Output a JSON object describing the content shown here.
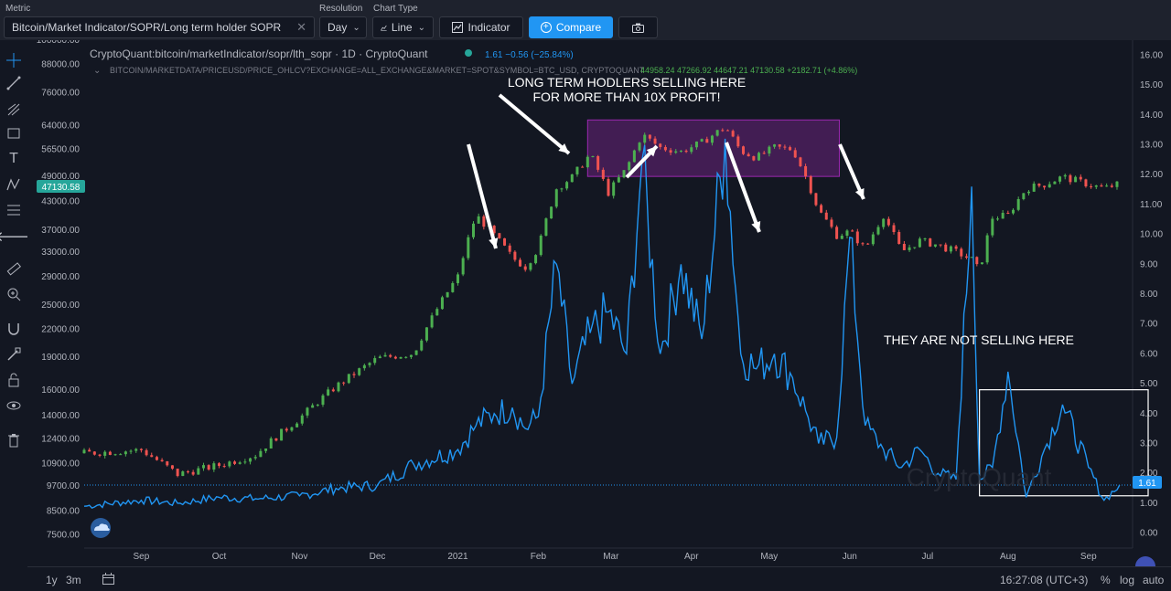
{
  "topbar": {
    "metric_label": "Metric",
    "metric_value": "Bitcoin/Market Indicator/SOPR/Long term holder SOPR",
    "resolution_label": "Resolution",
    "resolution_value": "Day",
    "chart_type_label": "Chart Type",
    "chart_type_value": "Line",
    "indicator_label": "Indicator",
    "compare_label": "Compare"
  },
  "legend": {
    "main_title": "CryptoQuant:bitcoin/marketIndicator/sopr/lth_sopr · 1D · CryptoQuant",
    "main_value": "1.61 −0.56 (−25.84%)",
    "price_title": "BITCOIN/MARKETDATA/PRICEUSD/PRICE_OHLCV?EXCHANGE=ALL_EXCHANGE&MARKET=SPOT&SYMBOL=BTC_USD, CRYPTOQUANT",
    "price_values": "44958.24 47266.92 44647.21 47130.58 +2182.71 (+4.86%)"
  },
  "price_badge": "47130.58",
  "sopr_badge": "1.61",
  "watermark": "CryptoQuant",
  "bottom": {
    "range_1y": "1y",
    "range_3m": "3m",
    "time": "16:27:08 (UTC+3)",
    "pct": "%",
    "log": "log",
    "auto": "auto"
  },
  "colors": {
    "background": "#131722",
    "sopr_line": "#2196f3",
    "candle_up": "#4caf50",
    "candle_down": "#ef5350",
    "badge_green": "#26a69a",
    "accent": "#2196f3"
  },
  "chart_data": {
    "type": "line",
    "x": [
      "2020-08-10",
      "2020-09-01",
      "2020-09-15",
      "2020-10-01",
      "2020-10-15",
      "2020-11-01",
      "2020-11-15",
      "2020-12-01",
      "2020-12-15",
      "2021-01-01",
      "2021-01-08",
      "2021-01-15",
      "2021-01-22",
      "2021-01-27",
      "2021-02-01",
      "2021-02-08",
      "2021-02-14",
      "2021-02-21",
      "2021-02-28",
      "2021-03-07",
      "2021-03-13",
      "2021-03-20",
      "2021-03-28",
      "2021-04-05",
      "2021-04-14",
      "2021-04-20",
      "2021-04-26",
      "2021-05-03",
      "2021-05-10",
      "2021-05-15",
      "2021-05-20",
      "2021-05-27",
      "2021-06-01",
      "2021-06-07",
      "2021-06-14",
      "2021-06-21",
      "2021-06-28",
      "2021-07-05",
      "2021-07-12",
      "2021-07-18",
      "2021-07-21",
      "2021-07-26",
      "2021-08-01",
      "2021-08-08",
      "2021-08-15",
      "2021-08-22",
      "2021-09-01",
      "2021-09-07",
      "2021-09-13"
    ],
    "series": [
      {
        "values": [
          0.9,
          1.1,
          1.0,
          1.2,
          1.15,
          1.25,
          1.5,
          1.6,
          2.3,
          2.8,
          3.6,
          4.0,
          4.2,
          3.5,
          3.9,
          9.0,
          5.0,
          6.7,
          7.4,
          6.0,
          12.5,
          6.0,
          9.0,
          6.5,
          13.2,
          6.0,
          5.5,
          6.0,
          5.2,
          4.1,
          3.0,
          3.2,
          9.9,
          3.6,
          2.8,
          2.2,
          2.8,
          2.0,
          1.8,
          11.6,
          1.8,
          2.2,
          5.4,
          1.2,
          2.8,
          4.3,
          2.2,
          1.1,
          1.61
        ]
      },
      {
        "values": [
          11500,
          11700,
          10300,
          10800,
          11400,
          13800,
          16300,
          18900,
          19400,
          29000,
          40000,
          36000,
          32000,
          30500,
          33600,
          46000,
          48800,
          55000,
          45000,
          51000,
          61000,
          57000,
          55800,
          58500,
          63500,
          56000,
          54000,
          57000,
          56500,
          49000,
          41000,
          36000,
          36700,
          33500,
          40000,
          33000,
          35000,
          34200,
          33000,
          31700,
          29800,
          39500,
          40000,
          46000,
          47000,
          48900,
          47000,
          46000,
          47130
        ]
      }
    ],
    "ylim_left": [
      7000,
      100000
    ],
    "ylim_right": [
      -0.5,
      16.5
    ],
    "y_ticks_left": [
      "100000.00",
      "88000.00",
      "76000.00",
      "64000.00",
      "56500.00",
      "49000.00",
      "43000.00",
      "37000.00",
      "33000.00",
      "29000.00",
      "25000.00",
      "22000.00",
      "19000.00",
      "16000.00",
      "14000.00",
      "12400.00",
      "10900.00",
      "9700.00",
      "8500.00",
      "7500.00"
    ],
    "y_ticks_right": [
      "16.00",
      "15.00",
      "14.00",
      "13.00",
      "12.00",
      "11.00",
      "10.00",
      "9.00",
      "8.00",
      "7.00",
      "6.00",
      "5.00",
      "4.00",
      "3.00",
      "2.00",
      "1.00",
      "0.00"
    ],
    "x_ticks": [
      "Sep",
      "Oct",
      "Nov",
      "Dec",
      "2021",
      "Feb",
      "Mar",
      "Apr",
      "May",
      "Jun",
      "Jul",
      "Aug",
      "Sep"
    ],
    "annotations": {
      "top": [
        "LONG TERM HODLERS SELLING HERE",
        "FOR MORE THAN 10X PROFIT!"
      ],
      "right": "THEY ARE NOT SELLING HERE"
    },
    "log_scale_left": true,
    "grid": false
  }
}
